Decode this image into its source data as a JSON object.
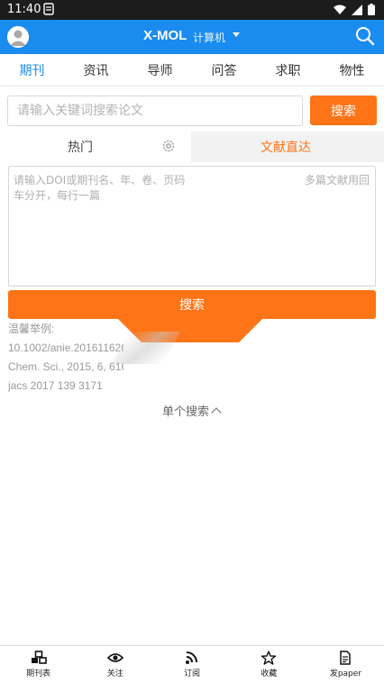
{
  "status_bar": {
    "time": "11:40",
    "note_icon": "notification-icon"
  },
  "app_bar": {
    "brand": "X-MOL",
    "subject": "计算机"
  },
  "tabs": [
    {
      "label": "期刊",
      "active": true
    },
    {
      "label": "资讯",
      "active": false
    },
    {
      "label": "导师",
      "active": false
    },
    {
      "label": "问答",
      "active": false
    },
    {
      "label": "求职",
      "active": false
    },
    {
      "label": "物性",
      "active": false
    }
  ],
  "search": {
    "placeholder": "请输入关键词搜索论文",
    "button": "搜索"
  },
  "sub_tabs": {
    "hot": "热门",
    "direct": "文献直达"
  },
  "doi_input": {
    "placeholder_line1": "请输入DOI或期刊名、年、卷、页码",
    "placeholder_right": "多篇文献用回",
    "placeholder_line2": "车分开，每行一篇"
  },
  "big_search_button": "搜索",
  "examples": {
    "title": "温馨举例:",
    "lines": [
      "10.1002/anie.201611626",
      "Chem. Sci., 2015, 6, 6165",
      "jacs 2017 139 3171"
    ]
  },
  "single_search": "单个搜索",
  "bottom_nav": [
    {
      "label": "期刊表",
      "icon": "cubes-icon"
    },
    {
      "label": "关注",
      "icon": "eye-icon"
    },
    {
      "label": "订阅",
      "icon": "rss-icon"
    },
    {
      "label": "收藏",
      "icon": "star-icon"
    },
    {
      "label": "发paper",
      "icon": "document-icon"
    }
  ],
  "colors": {
    "primary": "#1a8cf0",
    "accent": "#ff7417"
  }
}
